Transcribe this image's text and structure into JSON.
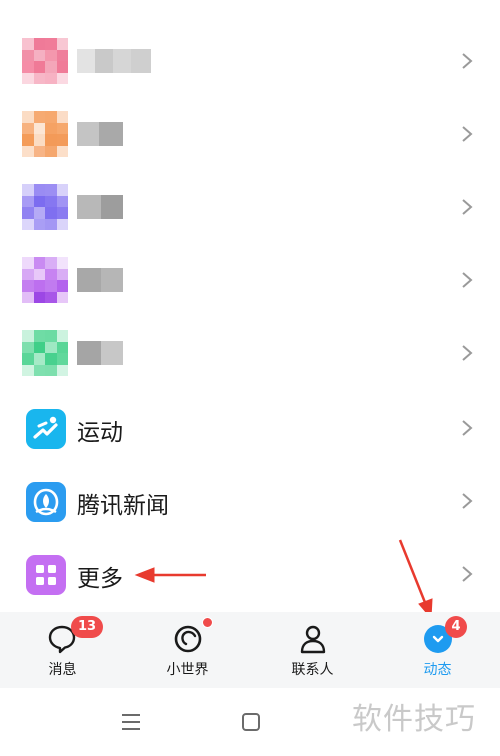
{
  "list": {
    "items": [
      {
        "label": "运动",
        "icon": "sport-icon",
        "color": "#1cb8f0"
      },
      {
        "label": "腾讯新闻",
        "icon": "tencent-news-icon",
        "color": "#2b9cf0"
      },
      {
        "label": "更多",
        "icon": "more-grid-icon",
        "color": "#c46ff2"
      }
    ],
    "blurred_rows": [
      {
        "icon": "blurred-icon",
        "color": "#f06a8a"
      },
      {
        "icon": "blurred-icon",
        "color": "#f5a45a"
      },
      {
        "icon": "blurred-icon",
        "color": "#8a7cf2"
      },
      {
        "icon": "blurred-icon",
        "color": "#c77ff0"
      },
      {
        "icon": "blurred-icon",
        "color": "#3fd08a"
      }
    ]
  },
  "tabbar": {
    "tabs": [
      {
        "label": "消息",
        "icon": "message-icon",
        "badge": "13"
      },
      {
        "label": "小世界",
        "icon": "small-world-icon",
        "dot": true
      },
      {
        "label": "联系人",
        "icon": "contacts-icon"
      },
      {
        "label": "动态",
        "icon": "dynamic-icon",
        "badge": "4",
        "active": true
      }
    ],
    "active_color": "#1e9bf0",
    "badge_color": "#f04b4b"
  },
  "system_nav": {
    "buttons": [
      "menu-icon",
      "home-square-icon"
    ]
  },
  "watermark": "软件技巧",
  "annotations": {
    "arrow_color": "#e83a2e"
  }
}
